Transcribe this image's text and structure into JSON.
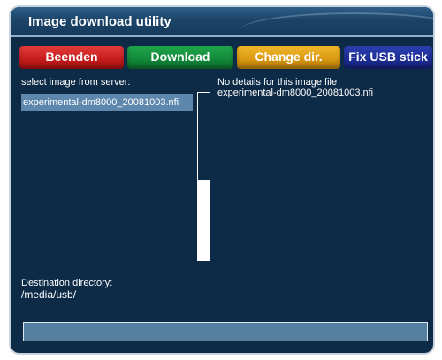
{
  "window": {
    "title": "Image download utility"
  },
  "buttons": {
    "red": "Beenden",
    "green": "Download",
    "yellow": "Change dir.",
    "blue": "Fix USB stick"
  },
  "image_list": {
    "heading": "select image from server:",
    "items": [
      "experimental-dm8000_20081003.nfi"
    ],
    "selected_index": 0,
    "scroll_position_fraction": 0.48
  },
  "details": {
    "line1": "No details for this image file",
    "line2": "experimental-dm8000_20081003.nfi"
  },
  "destination": {
    "label": "Destination directory:",
    "path": "/media/usb/"
  },
  "progress": {
    "value_fraction": 0
  },
  "colors": {
    "background": "#0d2a46",
    "selection": "#5d87ad",
    "red": "#d42626",
    "green": "#15913f",
    "yellow": "#e3a51a",
    "blue": "#22349f"
  }
}
